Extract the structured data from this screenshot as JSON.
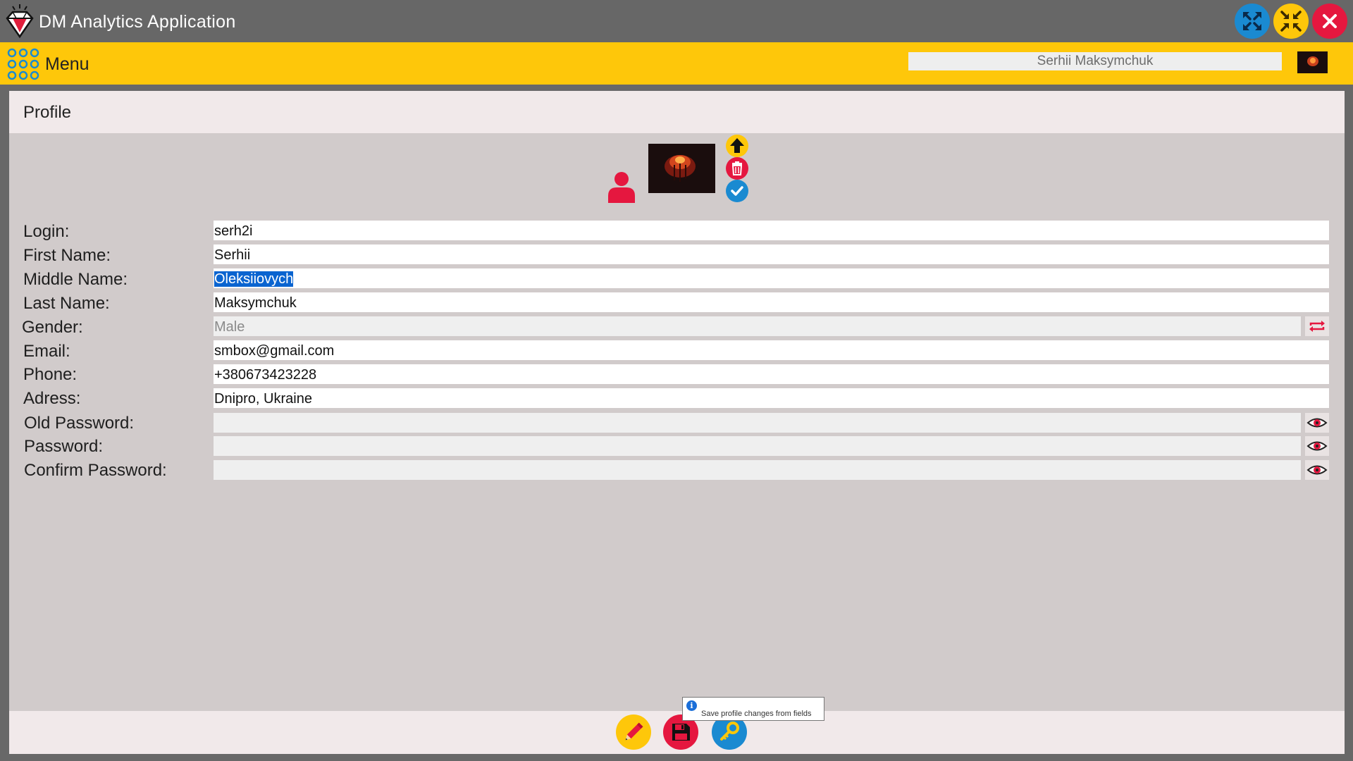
{
  "app": {
    "title": "DM Analytics Application",
    "icons": {
      "logo": "diamond-logo-icon",
      "maximize": "expand-arrows-icon",
      "restore": "compress-arrows-icon",
      "close": "close-icon"
    }
  },
  "menubar": {
    "menu_label": "Menu",
    "menu_icon": "grid-dots-icon",
    "user_name": "Serhii Maksymchuk"
  },
  "page": {
    "title": "Profile"
  },
  "avatar_actions": {
    "upload_icon": "arrow-up-icon",
    "delete_icon": "trash-icon",
    "confirm_icon": "check-icon",
    "person_icon": "person-icon"
  },
  "form": {
    "login": {
      "label": "Login:",
      "value": "serh2i"
    },
    "first_name": {
      "label": "First Name:",
      "value": "Serhii"
    },
    "middle_name": {
      "label": "Middle Name:",
      "value": "Oleksiiovych"
    },
    "last_name": {
      "label": "Last Name:",
      "value": "Maksymchuk"
    },
    "gender": {
      "label": "Gender:",
      "value": "Male"
    },
    "email": {
      "label": "Email:",
      "value": "smbox@gmail.com"
    },
    "phone": {
      "label": "Phone:",
      "value": "+380673423228"
    },
    "address": {
      "label": "Adress:",
      "value": "Dnipro, Ukraine"
    },
    "old_password": {
      "label": "Old Password:",
      "value": ""
    },
    "password": {
      "label": "Password:",
      "value": ""
    },
    "confirm_password": {
      "label": "Confirm Password:",
      "value": ""
    }
  },
  "footer": {
    "edit_icon": "pencil-icon",
    "save_icon": "floppy-disk-icon",
    "password_icon": "key-icon",
    "tooltip": "Save profile changes from fields"
  },
  "colors": {
    "titlebar": "#676767",
    "menubar": "#fec70a",
    "content": "#d1cbcb",
    "strip": "#f1e9ea",
    "blue": "#1a8ad1",
    "red": "#e5173f",
    "yellow": "#fec70a"
  }
}
